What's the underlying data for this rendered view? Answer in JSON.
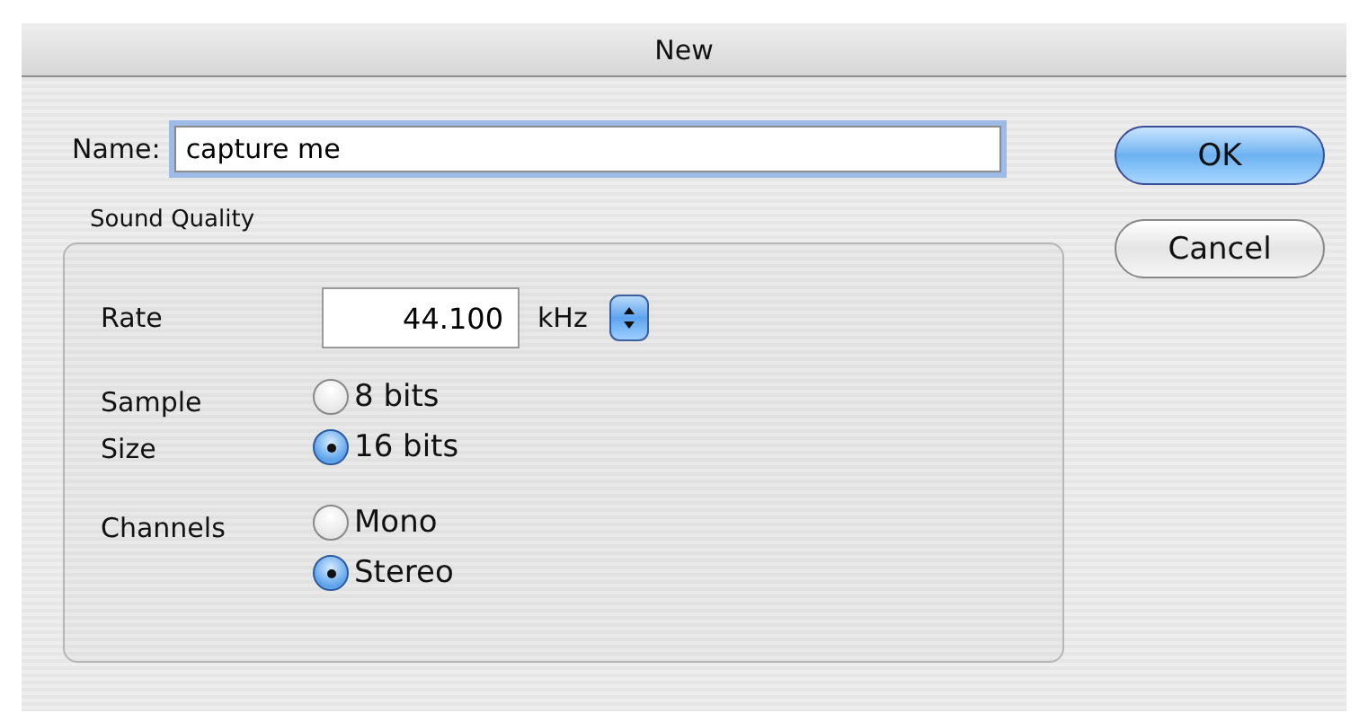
{
  "window": {
    "title": "New"
  },
  "name_field": {
    "label": "Name:",
    "value": "capture me"
  },
  "sound_quality": {
    "title": "Sound Quality",
    "rate": {
      "label": "Rate",
      "value": "44.100",
      "unit": "kHz"
    },
    "sample_size": {
      "label": "Sample Size",
      "options": [
        {
          "label": "8 bits",
          "selected": false
        },
        {
          "label": "16 bits",
          "selected": true
        }
      ]
    },
    "channels": {
      "label": "Channels",
      "options": [
        {
          "label": "Mono",
          "selected": false
        },
        {
          "label": "Stereo",
          "selected": true
        }
      ]
    }
  },
  "buttons": [
    {
      "label": "OK",
      "default": true
    },
    {
      "label": "Cancel",
      "default": false
    }
  ]
}
